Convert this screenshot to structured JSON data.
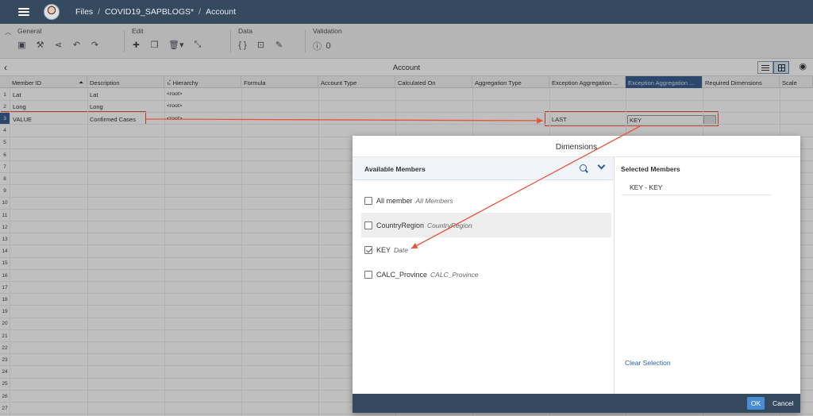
{
  "shell": {
    "breadcrumbs": [
      "Files",
      "COVID19_SAPBLOGS*",
      "Account"
    ],
    "separator": "/"
  },
  "toolbar": {
    "groups": [
      {
        "name": "General"
      },
      {
        "name": "Edit"
      },
      {
        "name": "Data",
        "braces": "{ }"
      },
      {
        "name": "Validation",
        "count": "0"
      }
    ]
  },
  "title": "Account",
  "grid": {
    "columns": [
      "Member ID",
      "Description",
      "Hierarchy",
      "Formula",
      "Account Type",
      "Calculated On",
      "Aggregation Type",
      "Exception Aggregation ...",
      "Exception Aggregation ...",
      "Required Dimensions",
      "Scale"
    ],
    "row_numbers": [
      "1",
      "2",
      "3",
      "4",
      "5",
      "6",
      "7",
      "8",
      "9",
      "10",
      "11",
      "12",
      "13",
      "14",
      "15",
      "16",
      "17",
      "18",
      "19",
      "20",
      "21",
      "22",
      "23",
      "24",
      "25",
      "26",
      "27"
    ],
    "rows": [
      {
        "member_id": "Lat",
        "description": "Lat",
        "hierarchy": "<root>"
      },
      {
        "member_id": "Long",
        "description": "Long",
        "hierarchy": "<root>"
      },
      {
        "member_id": "VALUE",
        "description": "Confirmed Cases",
        "hierarchy": "<root>",
        "exception_agg_type": "LAST",
        "exception_agg_dims": "KEY"
      }
    ]
  },
  "dialog": {
    "title": "Dimensions",
    "available_header": "Available Members",
    "members": [
      {
        "name": "All member",
        "desc": "All Members",
        "checked": false
      },
      {
        "name": "CountryRegion",
        "desc": "CountryRegion",
        "checked": false
      },
      {
        "name": "KEY",
        "desc": "Date",
        "checked": true
      },
      {
        "name": "CALC_Province",
        "desc": "CALC_Province",
        "checked": false
      }
    ],
    "selected_header": "Selected Members",
    "selected": [
      "KEY - KEY"
    ],
    "clear_label": "Clear Selection",
    "ok_label": "OK",
    "cancel_label": "Cancel"
  },
  "colors": {
    "shell": "#354a5f",
    "accent": "#4a8dd6",
    "annotation": "#e8543b",
    "selected_header": "#3a5f8f"
  }
}
